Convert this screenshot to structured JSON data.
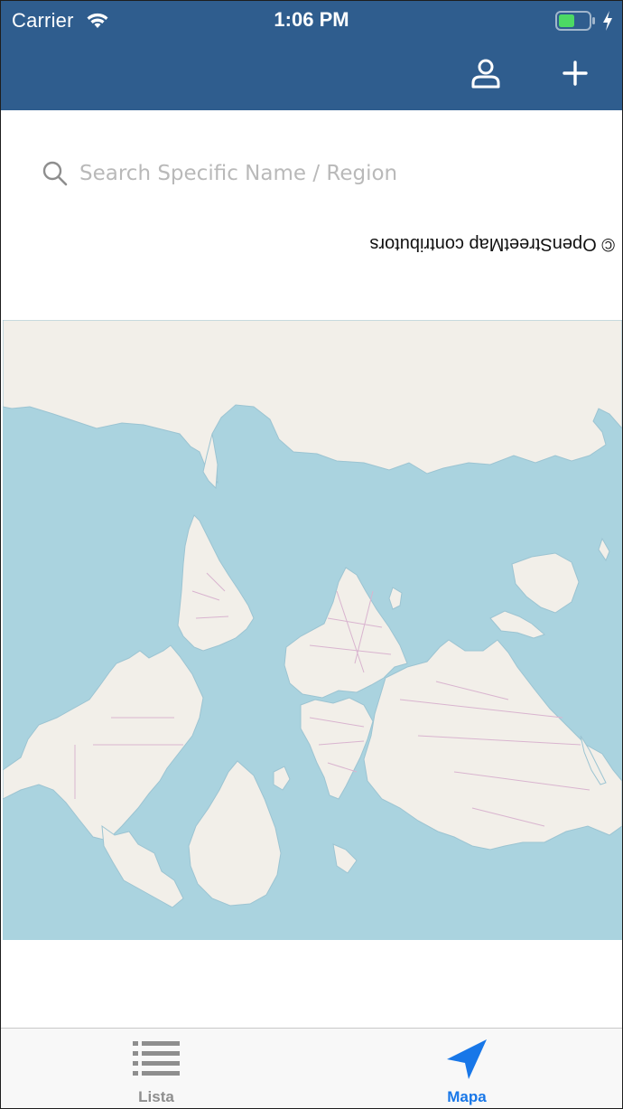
{
  "status_bar": {
    "carrier": "Carrier",
    "time": "1:06 PM",
    "battery_color": "#4cd964"
  },
  "nav_bar": {
    "background": "#2f5d8e",
    "icons": [
      "user-icon",
      "plus-icon"
    ]
  },
  "search": {
    "placeholder": "Search Specific Name / Region",
    "value": "",
    "icon": "search-icon"
  },
  "map": {
    "attribution": "© OpenStreetMap contributors",
    "orientation": "upside-down",
    "water_color": "#aad3df",
    "land_color": "#f2efe9",
    "border_color": "#d9b4cf"
  },
  "tab_bar": {
    "tabs": [
      {
        "label": "Lista",
        "icon": "list-icon",
        "active": false
      },
      {
        "label": "Mapa",
        "icon": "location-arrow-icon",
        "active": true
      }
    ],
    "active_color": "#1877e8",
    "inactive_color": "#8e8e8e"
  }
}
